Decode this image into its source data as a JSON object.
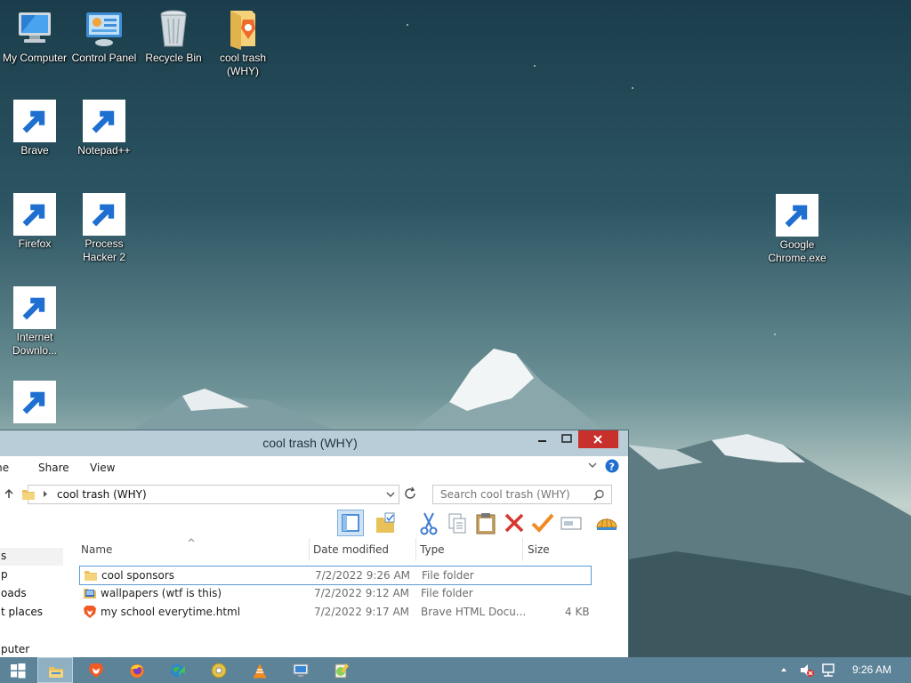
{
  "desktop": {
    "icons": [
      {
        "name": "my-computer",
        "label": "My Computer"
      },
      {
        "name": "control-panel",
        "label": "Control Panel"
      },
      {
        "name": "recycle-bin",
        "label": "Recycle Bin"
      },
      {
        "name": "cool-trash-folder",
        "label": "cool trash (WHY)"
      },
      {
        "name": "brave",
        "label": "Brave"
      },
      {
        "name": "notepad-plus-plus",
        "label": "Notepad++"
      },
      {
        "name": "firefox",
        "label": "Firefox"
      },
      {
        "name": "process-hacker",
        "label": "Process Hacker 2"
      },
      {
        "name": "internet-download-manager",
        "label": "Internet Downlo..."
      },
      {
        "name": "burn-disc",
        "label": ""
      },
      {
        "name": "google-chrome-exe",
        "label": "Google Chrome.exe"
      }
    ]
  },
  "window": {
    "title": "cool trash (WHY)",
    "ribbon_tabs": [
      "me",
      "Share",
      "View"
    ],
    "address": "cool trash (WHY)",
    "search_placeholder": "Search cool trash (WHY)",
    "columns": [
      "Name",
      "Date modified",
      "Type",
      "Size"
    ],
    "nav_items": [
      "s",
      "p",
      "oads",
      "t places",
      "puter"
    ],
    "files": [
      {
        "name": "cool sponsors",
        "date": "7/2/2022 9:26 AM",
        "type": "File folder",
        "size": "",
        "icon": "folder-icon",
        "selected": true
      },
      {
        "name": "wallpapers (wtf is this)",
        "date": "7/2/2022 9:12 AM",
        "type": "File folder",
        "size": "",
        "icon": "image-folder-icon",
        "selected": false
      },
      {
        "name": "my school everytime.html",
        "date": "7/2/2022 9:17 AM",
        "type": "Brave HTML Docu...",
        "size": "4 KB",
        "icon": "brave-html-icon",
        "selected": false
      }
    ]
  },
  "taskbar": {
    "clock": "9:26 AM",
    "apps": [
      "start-icon",
      "file-explorer-icon",
      "brave-icon",
      "firefox-icon",
      "internet-download-manager-icon",
      "burn-disc-icon",
      "vlc-icon",
      "remote-desktop-icon",
      "notepad-plus-plus-icon"
    ]
  },
  "colors": {
    "close_button": "#c7302c",
    "taskbar": "#5d8398",
    "selection": "#5b9bd8"
  }
}
